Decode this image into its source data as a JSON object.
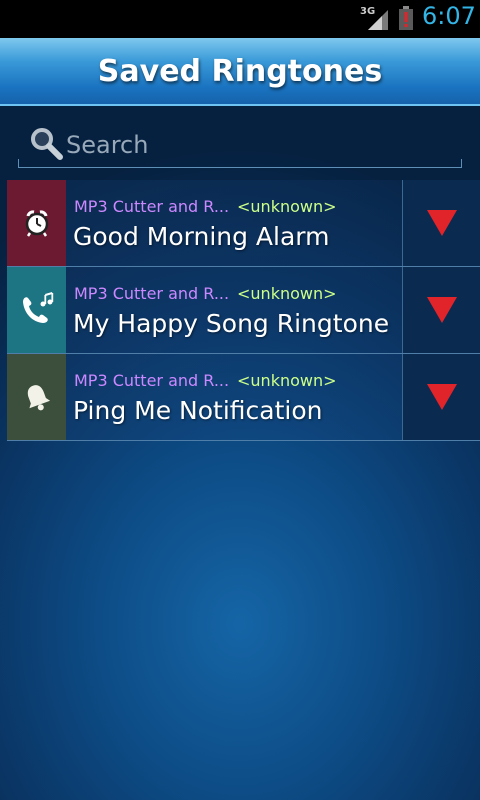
{
  "status_bar": {
    "network": "3G",
    "time": "6:07",
    "icons": [
      "signal-icon",
      "battery-alert-icon"
    ]
  },
  "header": {
    "title": "Saved Ringtones"
  },
  "search": {
    "placeholder": "Search",
    "value": ""
  },
  "ringtones": [
    {
      "artist": "MP3 Cutter and R...",
      "album": "<unknown>",
      "name": "Good Morning Alarm",
      "type_icon": "alarm-clock-icon",
      "type_color": "#6b1a32"
    },
    {
      "artist": "MP3 Cutter and R...",
      "album": "<unknown>",
      "name": "My Happy Song Ringtone",
      "type_icon": "phone-music-icon",
      "type_color": "#1d7482"
    },
    {
      "artist": "MP3 Cutter and R...",
      "album": "<unknown>",
      "name": "Ping Me Notification",
      "type_icon": "bell-icon",
      "type_color": "#3b4f3c"
    }
  ],
  "colors": {
    "artist_text": "#cc88ff",
    "album_text": "#ccff88",
    "menu_arrow": "#e0242a",
    "accent": "#33b5e5"
  }
}
